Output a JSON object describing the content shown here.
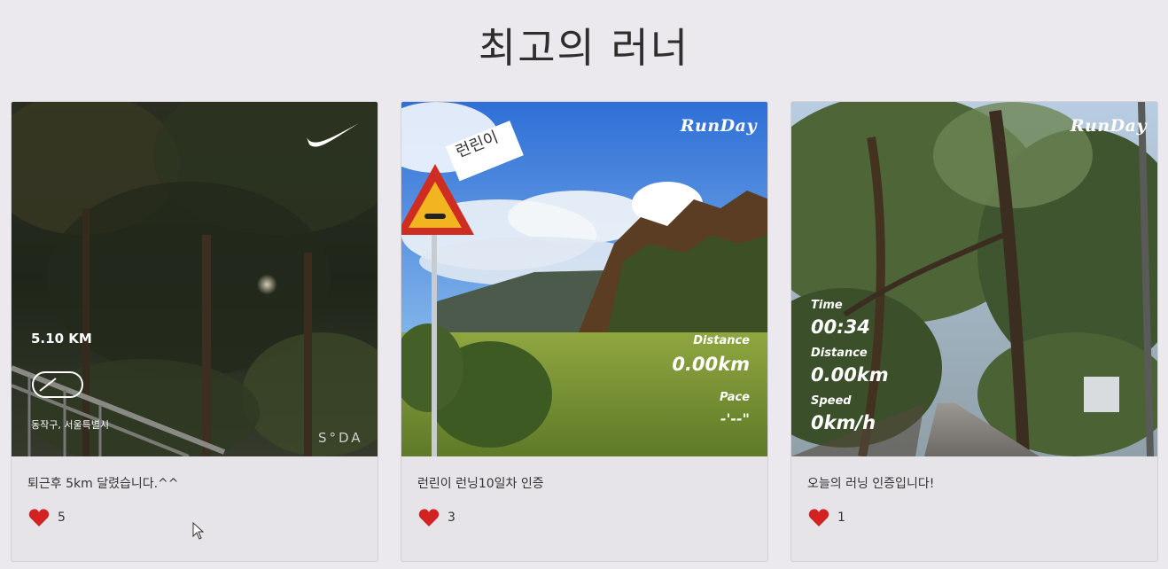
{
  "page": {
    "title": "최고의 러너"
  },
  "posts": [
    {
      "caption": "퇴근후 5km 달렸습니다.^^",
      "likes": "5",
      "photo": {
        "distance": "5.10 KM",
        "location": "동작구, 서울특별시",
        "watermark": "S°DA",
        "brand_icon": "swoosh-logo"
      }
    },
    {
      "caption": "런린이 런닝10일차 인증",
      "likes": "3",
      "photo": {
        "logo": "RunDay",
        "sticker": "런린이",
        "distance_label": "Distance",
        "distance_value": "0.00km",
        "pace_label": "Pace",
        "pace_value": "-'--\""
      }
    },
    {
      "caption": "오늘의 러닝 인증입니다!",
      "likes": "1",
      "photo": {
        "logo": "RunDay",
        "time_label": "Time",
        "time_value": "00:34",
        "distance_label": "Distance",
        "distance_value": "0.00km",
        "speed_label": "Speed",
        "speed_value": "0km/h"
      }
    }
  ],
  "colors": {
    "heart": "#d32222",
    "background": "#ebe9ed"
  }
}
